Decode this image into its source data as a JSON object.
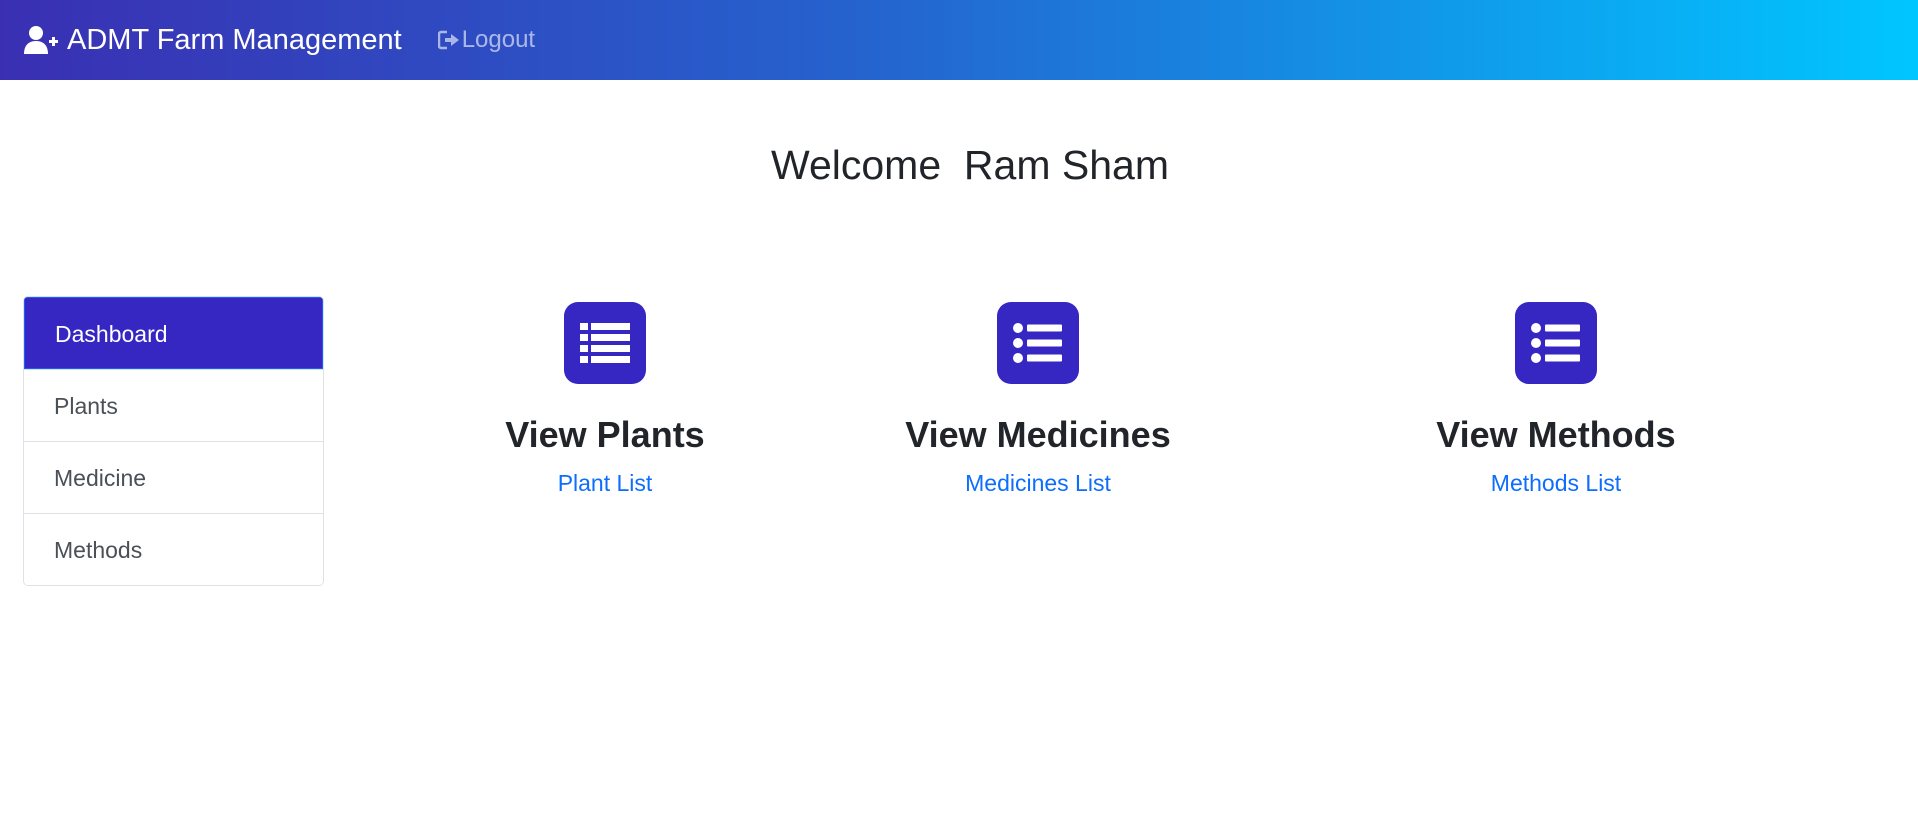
{
  "navbar": {
    "brand_icon": "user-plus-icon",
    "brand": "ADMT Farm Management",
    "logout_icon": "sign-out-icon",
    "logout": "Logout"
  },
  "welcome": "Welcome  Ram Sham",
  "sidebar": {
    "items": [
      {
        "label": "Dashboard",
        "active": true
      },
      {
        "label": "Plants"
      },
      {
        "label": "Medicine"
      },
      {
        "label": "Methods"
      }
    ]
  },
  "cards": [
    {
      "icon": "list-icon",
      "title": "View Plants",
      "link": "Plant List"
    },
    {
      "icon": "list-ul-icon",
      "title": "View Medicines",
      "link": "Medicines List"
    },
    {
      "icon": "list-ul-icon",
      "title": "View Methods",
      "link": "Methods List"
    }
  ],
  "colors": {
    "accent": "#3626c2",
    "link": "#0d6efd",
    "navbar_start": "#3a2fb3",
    "navbar_end": "#00c6ff"
  }
}
